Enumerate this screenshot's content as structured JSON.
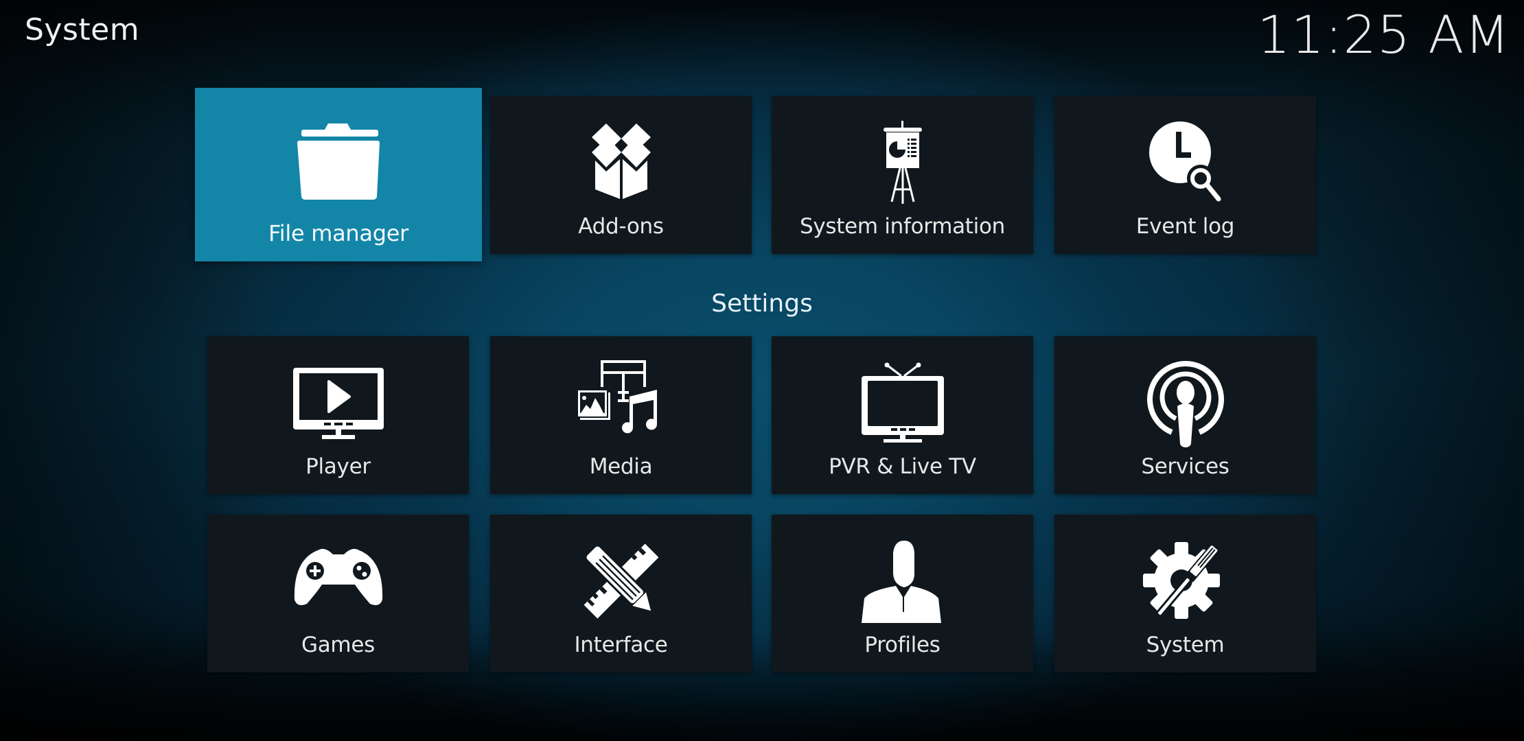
{
  "header": {
    "title": "System",
    "clock": "11:25 AM"
  },
  "colors": {
    "focused_tile": "#1386a8",
    "tile": "#10181d",
    "background_accent": "#0a4e6c"
  },
  "top_row": [
    {
      "label": "File manager",
      "icon": "folder-icon",
      "focused": true
    },
    {
      "label": "Add-ons",
      "icon": "open-box-icon",
      "focused": false
    },
    {
      "label": "System information",
      "icon": "presentation-easel-icon",
      "focused": false
    },
    {
      "label": "Event log",
      "icon": "clock-search-icon",
      "focused": false
    }
  ],
  "settings": {
    "heading": "Settings",
    "items": [
      {
        "label": "Player",
        "icon": "monitor-play-icon"
      },
      {
        "label": "Media",
        "icon": "media-library-icon"
      },
      {
        "label": "PVR & Live TV",
        "icon": "tv-antenna-icon"
      },
      {
        "label": "Services",
        "icon": "broadcast-person-icon"
      },
      {
        "label": "Games",
        "icon": "gamepad-icon"
      },
      {
        "label": "Interface",
        "icon": "ruler-pencil-icon"
      },
      {
        "label": "Profiles",
        "icon": "user-silhouette-icon"
      },
      {
        "label": "System",
        "icon": "gear-wrench-icon"
      }
    ]
  }
}
